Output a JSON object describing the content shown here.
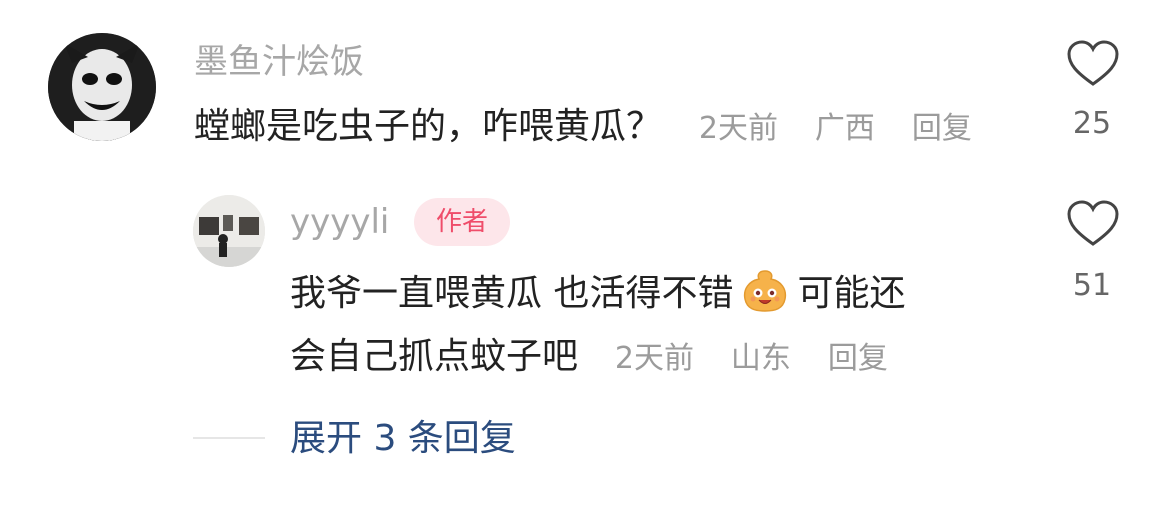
{
  "comment": {
    "user_name": "墨鱼汁烩饭",
    "text": "螳螂是吃虫子的，咋喂黄瓜？",
    "time": "2天前",
    "location": "广西",
    "reply_label": "回复",
    "like_count": "25",
    "avatar_icon": "clown-avatar"
  },
  "reply": {
    "user_name": "yyyyli",
    "badge": "作者",
    "text_line1_a": "我爷一直喂黄瓜 也活得不错",
    "emoji_icon": "smiling-face-emoji",
    "text_line1_b": "可能还",
    "text_line2": "会自己抓点蚊子吧",
    "time": "2天前",
    "location": "山东",
    "reply_label": "回复",
    "like_count": "51",
    "avatar_icon": "gallery-avatar"
  },
  "expand": {
    "label": "展开 3 条回复"
  },
  "colors": {
    "meta_gray": "#9b9b9b",
    "badge_bg": "#fde6ea",
    "badge_text": "#ef4d6a",
    "expand_blue": "#2b4c7e"
  }
}
